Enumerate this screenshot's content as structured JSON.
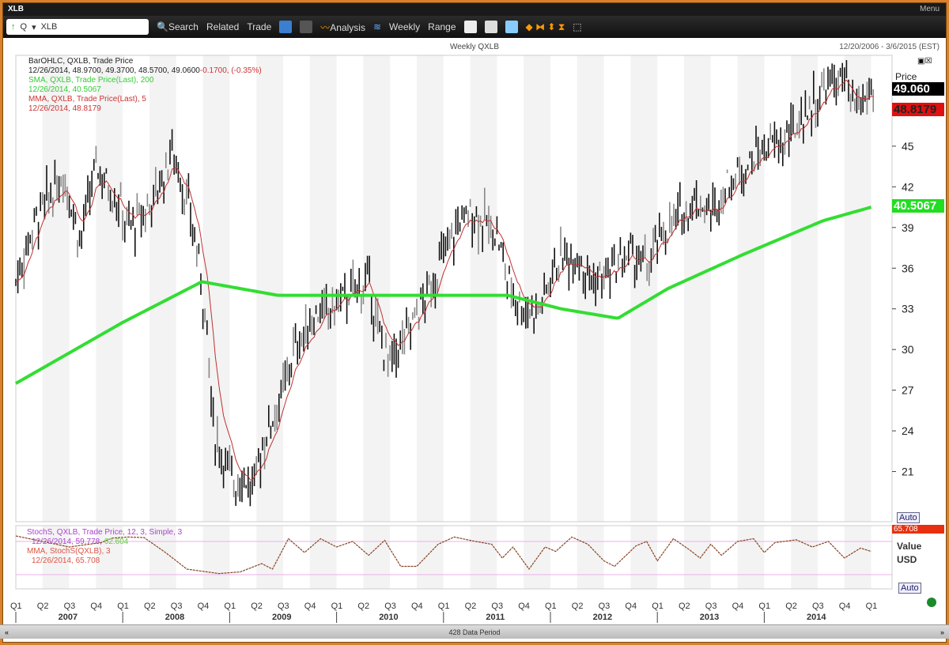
{
  "window": {
    "title": "XLB",
    "menu": "Menu"
  },
  "toolbar": {
    "ticker_prefix": "Q",
    "ticker_value": "XLB",
    "search": "Search",
    "related": "Related",
    "trade": "Trade",
    "analysis": "Analysis",
    "interval": "Weekly",
    "range": "Range"
  },
  "header": {
    "chart_title": "Weekly QXLB",
    "date_range": "12/20/2006 - 3/6/2015 (EST)"
  },
  "legend": {
    "bar_title": "BarOHLC, QXLB, Trade Price",
    "bar_values": "12/26/2014, 48.9700, 49.3700, 48.5700, 49.0600",
    "bar_change": "-0.1700, (-0.35%)",
    "sma_title": "SMA, QXLB, Trade Price(Last), 200",
    "sma_value": "12/26/2014, 40.5067",
    "mma_title": "MMA, QXLB, Trade Price(Last), 5",
    "mma_value": "12/26/2014, 48.8179",
    "stoch_title": "StochS, QXLB, Trade Price, 12, 3, Simple, 3",
    "stoch_values": "12/26/2014, 59.778,",
    "stoch_values2": "62.604",
    "stoch_mma_title": "MMA, StochS(QXLB), 3",
    "stoch_mma_value": "12/26/2014, 65.708"
  },
  "axis": {
    "price_label": "Price",
    "price_current": "49.060",
    "mma_current": "48.8179",
    "sma_current": "40.5067",
    "stoch_current": "65.708",
    "value_label": "Value",
    "currency": "USD",
    "auto": "Auto"
  },
  "footer": {
    "period": "428 Data Period"
  },
  "colors": {
    "sma": "#33dd33",
    "mma": "#c03030",
    "bars": "#111111",
    "stoch": "#884422",
    "band": "#e8b0e8"
  },
  "chart_data": {
    "type": "line",
    "title": "Weekly QXLB",
    "ylim": [
      17.3,
      51.7
    ],
    "yticks": [
      21,
      24,
      27,
      30,
      33,
      36,
      39,
      42,
      45
    ],
    "xlim": [
      2007.0,
      2015.2
    ],
    "quarter_labels": [
      "Q1",
      "Q2",
      "Q3",
      "Q4"
    ],
    "years": [
      "2007",
      "2008",
      "2009",
      "2010",
      "2011",
      "2012",
      "2013",
      "2014"
    ],
    "price_path": [
      [
        2007.0,
        35
      ],
      [
        2007.15,
        39
      ],
      [
        2007.3,
        41
      ],
      [
        2007.45,
        43
      ],
      [
        2007.6,
        38
      ],
      [
        2007.75,
        43.5
      ],
      [
        2007.95,
        41
      ],
      [
        2008.05,
        39
      ],
      [
        2008.2,
        40
      ],
      [
        2008.4,
        43
      ],
      [
        2008.45,
        45
      ],
      [
        2008.6,
        41
      ],
      [
        2008.7,
        37
      ],
      [
        2008.78,
        32
      ],
      [
        2008.85,
        24
      ],
      [
        2008.95,
        22
      ],
      [
        2009.05,
        20
      ],
      [
        2009.13,
        21
      ],
      [
        2009.2,
        19.5
      ],
      [
        2009.35,
        24
      ],
      [
        2009.5,
        27
      ],
      [
        2009.6,
        30
      ],
      [
        2009.8,
        32.5
      ],
      [
        2009.95,
        33
      ],
      [
        2010.1,
        34
      ],
      [
        2010.3,
        35
      ],
      [
        2010.4,
        31
      ],
      [
        2010.5,
        29
      ],
      [
        2010.6,
        30.5
      ],
      [
        2010.85,
        34
      ],
      [
        2011.0,
        37
      ],
      [
        2011.15,
        39.5
      ],
      [
        2011.3,
        40
      ],
      [
        2011.5,
        38.5
      ],
      [
        2011.6,
        35
      ],
      [
        2011.75,
        33
      ],
      [
        2011.9,
        33
      ],
      [
        2012.05,
        36.5
      ],
      [
        2012.25,
        37
      ],
      [
        2012.4,
        35
      ],
      [
        2012.55,
        35.5
      ],
      [
        2012.75,
        37
      ],
      [
        2012.9,
        36
      ],
      [
        2013.05,
        38.5
      ],
      [
        2013.35,
        41
      ],
      [
        2013.5,
        40
      ],
      [
        2013.65,
        42
      ],
      [
        2013.95,
        44.5
      ],
      [
        2014.2,
        45.5
      ],
      [
        2014.35,
        47
      ],
      [
        2014.6,
        49.5
      ],
      [
        2014.75,
        50
      ],
      [
        2014.82,
        47.5
      ],
      [
        2014.95,
        48.5
      ],
      [
        2015.0,
        49.06
      ]
    ],
    "sma200": [
      [
        2007.0,
        27.5
      ],
      [
        2008.0,
        32
      ],
      [
        2008.74,
        35
      ],
      [
        2009.45,
        34
      ],
      [
        2010.0,
        34
      ],
      [
        2011.1,
        34
      ],
      [
        2011.6,
        34
      ],
      [
        2012.1,
        33
      ],
      [
        2012.63,
        32.3
      ],
      [
        2013.1,
        34.5
      ],
      [
        2013.8,
        37
      ],
      [
        2014.55,
        39.5
      ],
      [
        2015.0,
        40.5
      ]
    ],
    "stoch": {
      "ylim": [
        0,
        100
      ],
      "bands": [
        80,
        20
      ],
      "path": [
        [
          2007.0,
          90
        ],
        [
          2007.2,
          82
        ],
        [
          2007.5,
          70
        ],
        [
          2007.8,
          78
        ],
        [
          2007.9,
          86
        ],
        [
          2008.05,
          88
        ],
        [
          2008.2,
          87
        ],
        [
          2008.4,
          60
        ],
        [
          2008.6,
          30
        ],
        [
          2008.9,
          22
        ],
        [
          2009.1,
          25
        ],
        [
          2009.3,
          40
        ],
        [
          2009.4,
          30
        ],
        [
          2009.55,
          85
        ],
        [
          2009.7,
          60
        ],
        [
          2009.85,
          85
        ],
        [
          2010.0,
          70
        ],
        [
          2010.15,
          80
        ],
        [
          2010.3,
          55
        ],
        [
          2010.45,
          82
        ],
        [
          2010.6,
          35
        ],
        [
          2010.75,
          35
        ],
        [
          2010.95,
          75
        ],
        [
          2011.1,
          88
        ],
        [
          2011.3,
          80
        ],
        [
          2011.45,
          75
        ],
        [
          2011.55,
          50
        ],
        [
          2011.65,
          70
        ],
        [
          2011.8,
          30
        ],
        [
          2011.95,
          70
        ],
        [
          2012.05,
          62
        ],
        [
          2012.2,
          88
        ],
        [
          2012.35,
          75
        ],
        [
          2012.5,
          45
        ],
        [
          2012.6,
          35
        ],
        [
          2012.8,
          72
        ],
        [
          2012.9,
          80
        ],
        [
          2013.0,
          45
        ],
        [
          2013.15,
          85
        ],
        [
          2013.3,
          65
        ],
        [
          2013.4,
          50
        ],
        [
          2013.5,
          75
        ],
        [
          2013.6,
          55
        ],
        [
          2013.75,
          80
        ],
        [
          2013.9,
          85
        ],
        [
          2014.0,
          60
        ],
        [
          2014.1,
          78
        ],
        [
          2014.3,
          83
        ],
        [
          2014.45,
          70
        ],
        [
          2014.6,
          80
        ],
        [
          2014.75,
          50
        ],
        [
          2014.9,
          68
        ],
        [
          2015.0,
          62
        ]
      ]
    }
  }
}
